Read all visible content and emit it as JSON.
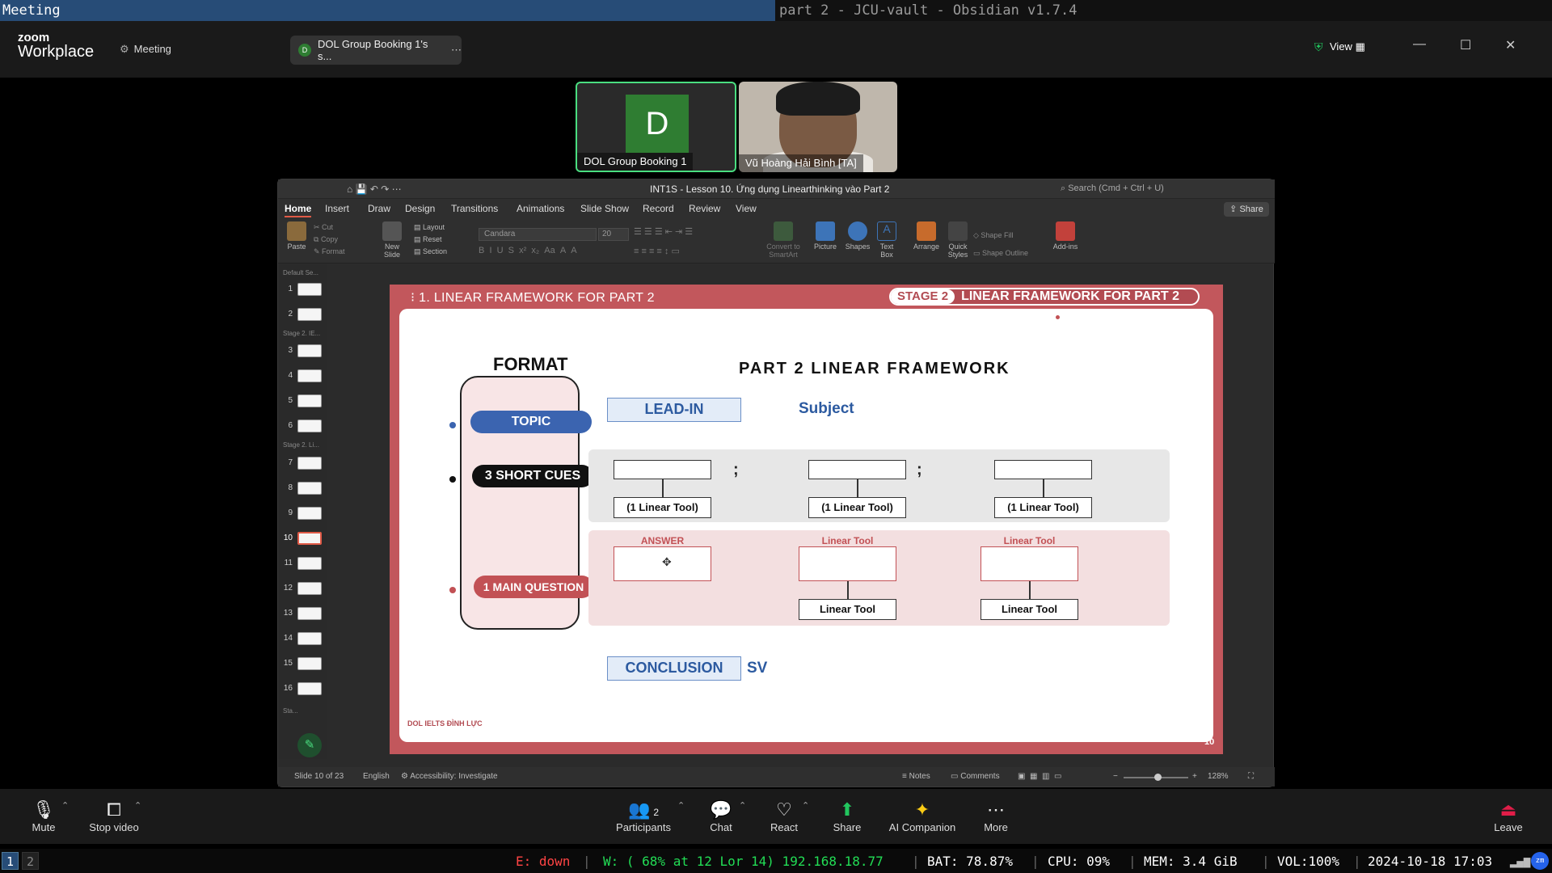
{
  "topbar": {
    "left_title": "Meeting",
    "right_title": "part 2 - JCU-vault - Obsidian v1.7.4"
  },
  "zoom": {
    "logo_top": "zoom",
    "logo_bottom": "Workplace",
    "meeting_label": "Meeting",
    "share_pill": {
      "avatar": "D",
      "label": "DOL Group Booking 1's s..."
    },
    "view_label": "View"
  },
  "participants": [
    {
      "name": "DOL Group Booking 1",
      "initial": "D"
    },
    {
      "name": "Vũ Hoàng Hải Bình [TA]"
    }
  ],
  "ppt": {
    "title": "INT1S - Lesson 10. Ứng dụng Linearthinking vào Part 2",
    "search": "Search (Cmd + Ctrl + U)",
    "share": "Share",
    "menu": [
      "Home",
      "Insert",
      "Draw",
      "Design",
      "Transitions",
      "Animations",
      "Slide Show",
      "Record",
      "Review",
      "View"
    ],
    "ribbon": {
      "paste": "Paste",
      "cut": "Cut",
      "copy": "Copy",
      "format": "Format",
      "new_slide": "New Slide",
      "layout": "Layout",
      "reset": "Reset",
      "section": "Section",
      "font": "Candara",
      "size": "20",
      "convert": "Convert to SmartArt",
      "picture": "Picture",
      "shapes": "Shapes",
      "textbox": "Text Box",
      "arrange": "Arrange",
      "quick_styles": "Quick Styles",
      "shape_fill": "Shape Fill",
      "shape_outline": "Shape Outline",
      "addins": "Add-ins"
    },
    "sections": [
      "Default Se...",
      "Stage 2. IE...",
      "Stage 2. Li...",
      "Sta..."
    ],
    "thumbs": [
      "1",
      "2",
      "3",
      "4",
      "5",
      "6",
      "7",
      "8",
      "9",
      "10",
      "11",
      "12",
      "13",
      "14",
      "15",
      "16"
    ],
    "status": {
      "slide": "Slide 10 of 23",
      "lang": "English",
      "access": "Accessibility: Investigate",
      "notes": "Notes",
      "comments": "Comments",
      "zoom": "128%"
    }
  },
  "slide": {
    "header_left": "1. LINEAR FRAMEWORK FOR PART 2",
    "stage": "STAGE 2",
    "header_right": "LINEAR FRAMEWORK FOR PART 2",
    "format": "FORMAT",
    "topic": "TOPIC",
    "cues": "3 SHORT CUES",
    "mainq": "1 MAIN QUESTION",
    "title": "PART 2 LINEAR FRAMEWORK",
    "leadin": "LEAD-IN",
    "subject": "Subject",
    "semi1": ";",
    "semi2": ";",
    "tool1": "(1 Linear Tool)",
    "tool2": "(1 Linear Tool)",
    "tool3": "(1 Linear Tool)",
    "answer": "ANSWER",
    "lt1": "Linear Tool",
    "lt2": "Linear Tool",
    "lt_box1": "Linear Tool",
    "lt_box2": "Linear Tool",
    "conclusion": "CONCLUSION",
    "sv": "SV",
    "logo": "DOL IELTS ĐÌNH LỰC",
    "page": "10"
  },
  "toolbar": {
    "mute": "Mute",
    "video": "Stop video",
    "participants": "Participants",
    "participants_count": "2",
    "chat": "Chat",
    "react": "React",
    "share": "Share",
    "ai": "AI Companion",
    "more": "More",
    "leave": "Leave"
  },
  "statusbar": {
    "ws1": "1",
    "ws2": "2",
    "eth": "E: down",
    "wifi": "W: ( 68% at 12 Lor 14) 192.168.18.77",
    "bat": "BAT: 78.87%",
    "cpu": "CPU: 09%",
    "mem": "MEM: 3.4 GiB",
    "vol": "VOL:100%",
    "time": "2024-10-18 17:03"
  }
}
